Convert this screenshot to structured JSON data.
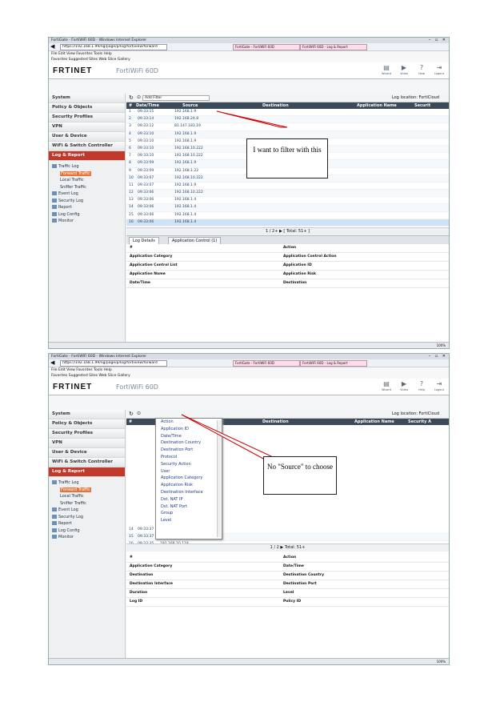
{
  "screens": [
    {
      "browser": {
        "title": "FortiGate - FortiWiFi 60D - Windows Internet Explorer",
        "address": "https://192.168.1.99/ng/page/p/log/fortiview/forward",
        "tab1": "FortiGate - FortiWiFi 60D",
        "tab2": "FortiWiFi 60D - Log & Report",
        "menu": "File  Edit  View  Favorites  Tools  Help",
        "favorites": "Favorites  Suggested Sites  Web Slice Gallery"
      },
      "header": {
        "logo": "FRTINET",
        "model": "FortiWiFi 60D",
        "icons": [
          {
            "label": "Wizard",
            "icon": "wizard-icon"
          },
          {
            "label": "Video",
            "icon": "video-icon"
          },
          {
            "label": "Help",
            "icon": "help-icon"
          },
          {
            "label": "Logout",
            "icon": "logout-icon"
          }
        ]
      },
      "sidebar": {
        "sections": [
          "System",
          "Policy & Objects",
          "Security Profiles",
          "VPN",
          "User & Device",
          "WiFi & Switch Controller",
          "Log & Report"
        ],
        "tree": [
          "Traffic Log",
          "Forward Traffic",
          "Local Traffic",
          "Sniffer Traffic",
          "Event Log",
          "Security Log",
          "Report",
          "Log Config",
          "Monitor"
        ]
      },
      "toolbar": {
        "filter": "Add Filter",
        "location": "Log location: FortiCloud"
      },
      "columns": [
        "#",
        "Date/Time",
        "Source",
        "Destination",
        "Application Name",
        "Securit"
      ],
      "rows": [
        {
          "n": "1",
          "t": "09:33:15",
          "s": "192.168.1.9"
        },
        {
          "n": "2",
          "t": "09:33:14",
          "s": "192.168.24.8"
        },
        {
          "n": "3",
          "t": "09:33:12",
          "s": "81.147.183.19"
        },
        {
          "n": "4",
          "t": "09:33:10",
          "s": "192.168.1.9"
        },
        {
          "n": "5",
          "t": "09:33:10",
          "s": "192.168.1.9"
        },
        {
          "n": "6",
          "t": "09:33:10",
          "s": "192.168.10.222"
        },
        {
          "n": "7",
          "t": "09:33:10",
          "s": "192.168.10.222"
        },
        {
          "n": "8",
          "t": "09:33:09",
          "s": "192.168.1.9"
        },
        {
          "n": "9",
          "t": "09:33:09",
          "s": "192.168.1.22"
        },
        {
          "n": "10",
          "t": "09:33:07",
          "s": "192.168.10.222"
        },
        {
          "n": "11",
          "t": "09:33:07",
          "s": "192.168.1.9"
        },
        {
          "n": "12",
          "t": "09:33:06",
          "s": "192.168.10.222"
        },
        {
          "n": "13",
          "t": "09:33:06",
          "s": "192.168.1.4"
        },
        {
          "n": "14",
          "t": "09:33:06",
          "s": "192.168.1.4"
        },
        {
          "n": "15",
          "t": "09:33:06",
          "s": "192.168.1.4"
        },
        {
          "n": "16",
          "t": "09:33:06",
          "s": "192.168.1.4"
        }
      ],
      "pager": "1  / 2+  ▶  [ Total: 51+ ]",
      "detail_tabs": [
        "Log Details",
        "Application Control (1)"
      ],
      "details": [
        [
          "#",
          "Action"
        ],
        [
          "Application Category",
          "Application Control Action"
        ],
        [
          "Application Control List",
          "Application ID"
        ],
        [
          "Application Name",
          "Application Risk"
        ],
        [
          "Date/Time",
          "Destination"
        ]
      ],
      "status": "100%",
      "callout": "I want to filter with this"
    },
    {
      "browser": {
        "title": "FortiGate - FortiWiFi 60D - Windows Internet Explorer",
        "address": "https://192.168.1.99/ng/page/p/log/fortiview/forward",
        "tab1": "FortiGate - FortiWiFi 60D",
        "tab2": "FortiWiFi 60D - Log & Report",
        "menu": "File  Edit  View  Favorites  Tools  Help",
        "favorites": "Favorites  Suggested Sites  Web Slice Gallery"
      },
      "header": {
        "logo": "FRTINET",
        "model": "FortiWiFi 60D",
        "icons": [
          {
            "label": "Wizard",
            "icon": "wizard-icon"
          },
          {
            "label": "Video",
            "icon": "video-icon"
          },
          {
            "label": "Help",
            "icon": "help-icon"
          },
          {
            "label": "Logout",
            "icon": "logout-icon"
          }
        ]
      },
      "sidebar": {
        "sections": [
          "System",
          "Policy & Objects",
          "Security Profiles",
          "VPN",
          "User & Device",
          "WiFi & Switch Controller",
          "Log & Report"
        ],
        "tree": [
          "Traffic Log",
          "Forward Traffic",
          "Local Traffic",
          "Sniffer Traffic",
          "Event Log",
          "Security Log",
          "Report",
          "Log Config",
          "Monitor"
        ]
      },
      "toolbar": {
        "filter": "",
        "location": "Log location: FortiCloud"
      },
      "columns": [
        "#",
        "Destination",
        "Application Name",
        "Security A"
      ],
      "menu_items": [
        "Action",
        "Application ID",
        "Date/Time",
        "Destination Country",
        "Destination Port",
        "Protocol",
        "Security Action",
        "User",
        "Application Category",
        "Application Risk",
        "Destination Interface",
        "Dst. NAT IP",
        "Dst. NAT Port",
        "Group",
        "Level"
      ],
      "rows": [
        {
          "n": "14",
          "t": "09:33:37",
          "s": "69.134.183.19"
        },
        {
          "n": "15",
          "t": "09:33:37",
          "s": "208.25.68.71"
        },
        {
          "n": "16",
          "t": "09:33:35",
          "s": "192.168.10.118"
        }
      ],
      "pager": "1  / 2  ▶  Total: 51+",
      "details": [
        [
          "#",
          "Action"
        ],
        [
          "Application Category",
          "Date/Time"
        ],
        [
          "Destination",
          "Destination Country"
        ],
        [
          "Destination Interface",
          "Destination Port"
        ],
        [
          "Duration",
          "Level"
        ],
        [
          "Log ID",
          "Policy ID"
        ]
      ],
      "status": "100%",
      "callout": "No \"Source\" to choose"
    }
  ]
}
